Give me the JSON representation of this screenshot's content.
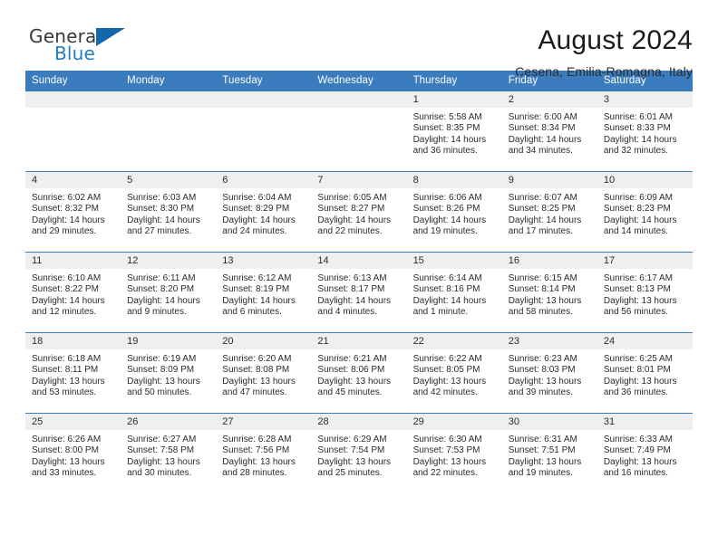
{
  "brand": {
    "name_top": "General",
    "name_bottom": "Blue",
    "icon": "blue-triangle-flag-icon",
    "color_top": "#3a3a3a",
    "color_bottom": "#1f7dc4",
    "accent": "#1667a8"
  },
  "header": {
    "title": "August 2024",
    "subtitle": "Cesena, Emilia-Romagna, Italy"
  },
  "theme": {
    "header_bg": "#3a7cbe",
    "daynum_bg": "#efefef",
    "text": "#2b2b2b"
  },
  "weekdays": [
    "Sunday",
    "Monday",
    "Tuesday",
    "Wednesday",
    "Thursday",
    "Friday",
    "Saturday"
  ],
  "weeks": [
    [
      {
        "day": "",
        "empty": true
      },
      {
        "day": "",
        "empty": true
      },
      {
        "day": "",
        "empty": true
      },
      {
        "day": "",
        "empty": true
      },
      {
        "day": "1",
        "sunrise": "Sunrise: 5:58 AM",
        "sunset": "Sunset: 8:35 PM",
        "daylight1": "Daylight: 14 hours",
        "daylight2": "and 36 minutes."
      },
      {
        "day": "2",
        "sunrise": "Sunrise: 6:00 AM",
        "sunset": "Sunset: 8:34 PM",
        "daylight1": "Daylight: 14 hours",
        "daylight2": "and 34 minutes."
      },
      {
        "day": "3",
        "sunrise": "Sunrise: 6:01 AM",
        "sunset": "Sunset: 8:33 PM",
        "daylight1": "Daylight: 14 hours",
        "daylight2": "and 32 minutes."
      }
    ],
    [
      {
        "day": "4",
        "sunrise": "Sunrise: 6:02 AM",
        "sunset": "Sunset: 8:32 PM",
        "daylight1": "Daylight: 14 hours",
        "daylight2": "and 29 minutes."
      },
      {
        "day": "5",
        "sunrise": "Sunrise: 6:03 AM",
        "sunset": "Sunset: 8:30 PM",
        "daylight1": "Daylight: 14 hours",
        "daylight2": "and 27 minutes."
      },
      {
        "day": "6",
        "sunrise": "Sunrise: 6:04 AM",
        "sunset": "Sunset: 8:29 PM",
        "daylight1": "Daylight: 14 hours",
        "daylight2": "and 24 minutes."
      },
      {
        "day": "7",
        "sunrise": "Sunrise: 6:05 AM",
        "sunset": "Sunset: 8:27 PM",
        "daylight1": "Daylight: 14 hours",
        "daylight2": "and 22 minutes."
      },
      {
        "day": "8",
        "sunrise": "Sunrise: 6:06 AM",
        "sunset": "Sunset: 8:26 PM",
        "daylight1": "Daylight: 14 hours",
        "daylight2": "and 19 minutes."
      },
      {
        "day": "9",
        "sunrise": "Sunrise: 6:07 AM",
        "sunset": "Sunset: 8:25 PM",
        "daylight1": "Daylight: 14 hours",
        "daylight2": "and 17 minutes."
      },
      {
        "day": "10",
        "sunrise": "Sunrise: 6:09 AM",
        "sunset": "Sunset: 8:23 PM",
        "daylight1": "Daylight: 14 hours",
        "daylight2": "and 14 minutes."
      }
    ],
    [
      {
        "day": "11",
        "sunrise": "Sunrise: 6:10 AM",
        "sunset": "Sunset: 8:22 PM",
        "daylight1": "Daylight: 14 hours",
        "daylight2": "and 12 minutes."
      },
      {
        "day": "12",
        "sunrise": "Sunrise: 6:11 AM",
        "sunset": "Sunset: 8:20 PM",
        "daylight1": "Daylight: 14 hours",
        "daylight2": "and 9 minutes."
      },
      {
        "day": "13",
        "sunrise": "Sunrise: 6:12 AM",
        "sunset": "Sunset: 8:19 PM",
        "daylight1": "Daylight: 14 hours",
        "daylight2": "and 6 minutes."
      },
      {
        "day": "14",
        "sunrise": "Sunrise: 6:13 AM",
        "sunset": "Sunset: 8:17 PM",
        "daylight1": "Daylight: 14 hours",
        "daylight2": "and 4 minutes."
      },
      {
        "day": "15",
        "sunrise": "Sunrise: 6:14 AM",
        "sunset": "Sunset: 8:16 PM",
        "daylight1": "Daylight: 14 hours",
        "daylight2": "and 1 minute."
      },
      {
        "day": "16",
        "sunrise": "Sunrise: 6:15 AM",
        "sunset": "Sunset: 8:14 PM",
        "daylight1": "Daylight: 13 hours",
        "daylight2": "and 58 minutes."
      },
      {
        "day": "17",
        "sunrise": "Sunrise: 6:17 AM",
        "sunset": "Sunset: 8:13 PM",
        "daylight1": "Daylight: 13 hours",
        "daylight2": "and 56 minutes."
      }
    ],
    [
      {
        "day": "18",
        "sunrise": "Sunrise: 6:18 AM",
        "sunset": "Sunset: 8:11 PM",
        "daylight1": "Daylight: 13 hours",
        "daylight2": "and 53 minutes."
      },
      {
        "day": "19",
        "sunrise": "Sunrise: 6:19 AM",
        "sunset": "Sunset: 8:09 PM",
        "daylight1": "Daylight: 13 hours",
        "daylight2": "and 50 minutes."
      },
      {
        "day": "20",
        "sunrise": "Sunrise: 6:20 AM",
        "sunset": "Sunset: 8:08 PM",
        "daylight1": "Daylight: 13 hours",
        "daylight2": "and 47 minutes."
      },
      {
        "day": "21",
        "sunrise": "Sunrise: 6:21 AM",
        "sunset": "Sunset: 8:06 PM",
        "daylight1": "Daylight: 13 hours",
        "daylight2": "and 45 minutes."
      },
      {
        "day": "22",
        "sunrise": "Sunrise: 6:22 AM",
        "sunset": "Sunset: 8:05 PM",
        "daylight1": "Daylight: 13 hours",
        "daylight2": "and 42 minutes."
      },
      {
        "day": "23",
        "sunrise": "Sunrise: 6:23 AM",
        "sunset": "Sunset: 8:03 PM",
        "daylight1": "Daylight: 13 hours",
        "daylight2": "and 39 minutes."
      },
      {
        "day": "24",
        "sunrise": "Sunrise: 6:25 AM",
        "sunset": "Sunset: 8:01 PM",
        "daylight1": "Daylight: 13 hours",
        "daylight2": "and 36 minutes."
      }
    ],
    [
      {
        "day": "25",
        "sunrise": "Sunrise: 6:26 AM",
        "sunset": "Sunset: 8:00 PM",
        "daylight1": "Daylight: 13 hours",
        "daylight2": "and 33 minutes."
      },
      {
        "day": "26",
        "sunrise": "Sunrise: 6:27 AM",
        "sunset": "Sunset: 7:58 PM",
        "daylight1": "Daylight: 13 hours",
        "daylight2": "and 30 minutes."
      },
      {
        "day": "27",
        "sunrise": "Sunrise: 6:28 AM",
        "sunset": "Sunset: 7:56 PM",
        "daylight1": "Daylight: 13 hours",
        "daylight2": "and 28 minutes."
      },
      {
        "day": "28",
        "sunrise": "Sunrise: 6:29 AM",
        "sunset": "Sunset: 7:54 PM",
        "daylight1": "Daylight: 13 hours",
        "daylight2": "and 25 minutes."
      },
      {
        "day": "29",
        "sunrise": "Sunrise: 6:30 AM",
        "sunset": "Sunset: 7:53 PM",
        "daylight1": "Daylight: 13 hours",
        "daylight2": "and 22 minutes."
      },
      {
        "day": "30",
        "sunrise": "Sunrise: 6:31 AM",
        "sunset": "Sunset: 7:51 PM",
        "daylight1": "Daylight: 13 hours",
        "daylight2": "and 19 minutes."
      },
      {
        "day": "31",
        "sunrise": "Sunrise: 6:33 AM",
        "sunset": "Sunset: 7:49 PM",
        "daylight1": "Daylight: 13 hours",
        "daylight2": "and 16 minutes."
      }
    ]
  ]
}
